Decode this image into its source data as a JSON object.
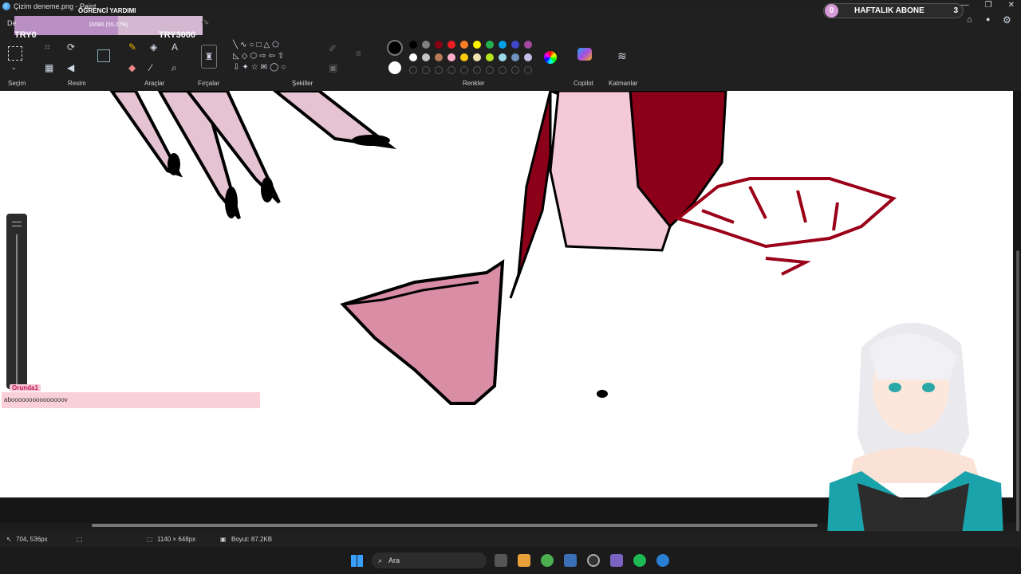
{
  "window": {
    "title": "Çizim deneme.png - Paint"
  },
  "overlay": {
    "label": "ÖĞRENCİ YARDIMI",
    "progress_text": "16586 (55.27%)",
    "progress_fraction": 0.5527,
    "left_try": "TRY0",
    "right_try": "TRY3000",
    "stub": "De"
  },
  "subscribe": {
    "count_left": "0",
    "label": "HAFTALIK ABONE",
    "count_right": "3"
  },
  "ribbon": {
    "groups": [
      "Seçim",
      "Resim",
      "Araçlar",
      "Fırçalar",
      "Şekiller",
      "Renkler",
      "Copilot",
      "Katmanlar"
    ]
  },
  "colors": {
    "primary": "#000000",
    "secondary": "#ffffff",
    "row1": [
      "#000000",
      "#7f7f7f",
      "#880015",
      "#ed1c24",
      "#ff7f27",
      "#fff200",
      "#22b14c",
      "#00a2e8",
      "#3f48cc",
      "#a349a4"
    ],
    "row2": [
      "#ffffff",
      "#c3c3c3",
      "#b97a57",
      "#ffaec9",
      "#ffc90e",
      "#efe4b0",
      "#b5e61d",
      "#99d9ea",
      "#7092be",
      "#c8bfe7"
    ]
  },
  "chat": {
    "user": "Orunda1",
    "message": "abooooooooooooooov"
  },
  "status": {
    "cursor": "704, 536px",
    "canvas_size": "1140 × 648px",
    "file_size": "Boyut: 87.2KB"
  },
  "taskbar": {
    "search_placeholder": "Ara"
  }
}
